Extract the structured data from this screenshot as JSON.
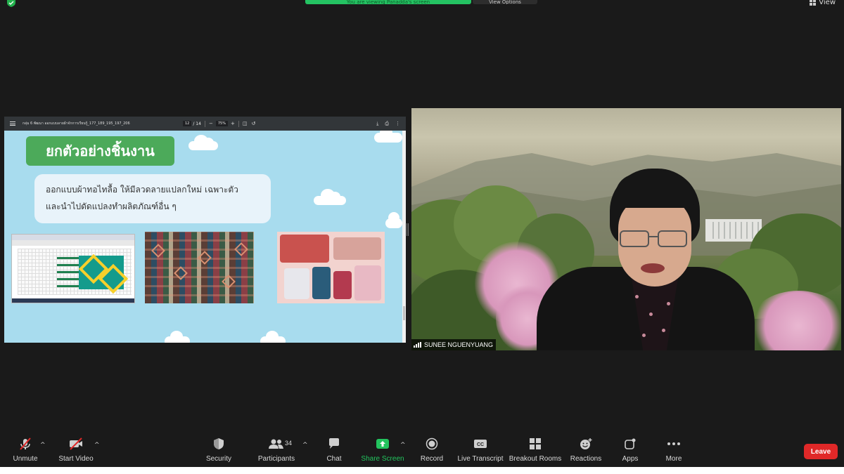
{
  "top": {
    "banner_text": "You are viewing Panadda's screen",
    "update_text": "View Options",
    "view_label": "View"
  },
  "pdf": {
    "filename": "กลุ่ม 6 พัฒนา ออกแบบลายผ้าจักการเรียนรู้_177_189_195_197_206",
    "page_current": "12",
    "page_total": "/ 14",
    "zoom": "75%"
  },
  "slide": {
    "title": "ยกตัวอย่างชิ้นงาน",
    "line1": "ออกแบบผ้าทอไทลื้อ ให้มีลวดลายแปลกใหม่ เฉพาะตัว",
    "line2": "และนำไปดัดแปลงทำผลิตภัณฑ์อื่น ๆ"
  },
  "video": {
    "participant_name": "SUNEE NGUENYUANG"
  },
  "toolbar": {
    "unmute": "Unmute",
    "start_video": "Start Video",
    "security": "Security",
    "participants": "Participants",
    "participants_count": "34",
    "chat": "Chat",
    "share_screen": "Share Screen",
    "record": "Record",
    "live_transcript": "Live Transcript",
    "breakout_rooms": "Breakout Rooms",
    "reactions": "Reactions",
    "apps": "Apps",
    "more": "More",
    "leave": "Leave",
    "caret": "^"
  },
  "colors": {
    "share_green": "#23c45e",
    "leave_red": "#e02828",
    "slide_bg": "#a8dcee",
    "title_green": "#4caa5a"
  }
}
